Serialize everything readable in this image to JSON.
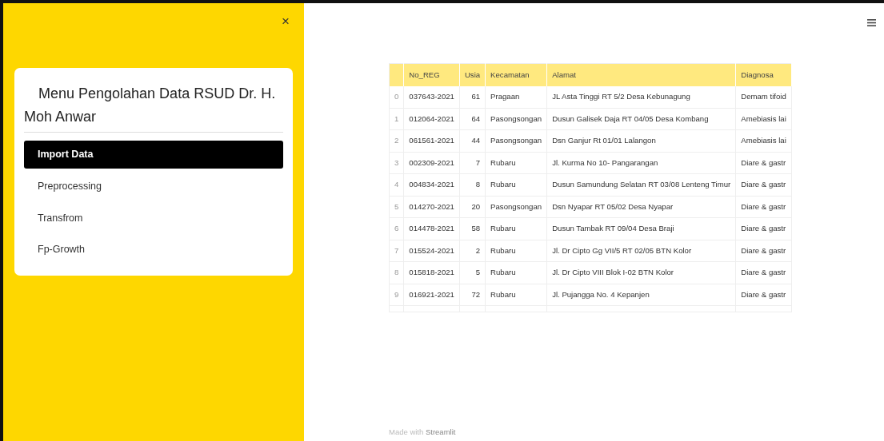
{
  "sidebar": {
    "close_label": "×",
    "menu_title": "Menu Pengolahan Data RSUD Dr. H. Moh Anwar",
    "items": [
      {
        "label": "Import Data",
        "selected": true
      },
      {
        "label": "Preprocessing",
        "selected": false
      },
      {
        "label": "Transfrom",
        "selected": false
      },
      {
        "label": "Fp-Growth",
        "selected": false
      }
    ]
  },
  "table": {
    "columns": [
      "",
      "No_REG",
      "Usia",
      "Kecamatan",
      "Alamat",
      "Diagnosa"
    ],
    "rows": [
      [
        "0",
        "037643-2021",
        "61",
        "Pragaan",
        "JL Asta Tinggi RT 5/2 Desa Kebunagung",
        "Demam tifoid"
      ],
      [
        "1",
        "012064-2021",
        "64",
        "Pasongsongan",
        "Dusun Galisek Daja RT 04/05 Desa Kombang",
        "Amebiasis lai"
      ],
      [
        "2",
        "061561-2021",
        "44",
        "Pasongsongan",
        "Dsn Ganjur Rt 01/01 Lalangon",
        "Amebiasis lai"
      ],
      [
        "3",
        "002309-2021",
        "7",
        "Rubaru",
        "Jl. Kurma No 10- Pangarangan",
        "Diare & gastr"
      ],
      [
        "4",
        "004834-2021",
        "8",
        "Rubaru",
        "Dusun Samundung Selatan RT 03/08 Lenteng Timur",
        "Diare & gastr"
      ],
      [
        "5",
        "014270-2021",
        "20",
        "Pasongsongan",
        "Dsn Nyapar RT 05/02 Desa Nyapar",
        "Diare & gastr"
      ],
      [
        "6",
        "014478-2021",
        "58",
        "Rubaru",
        "Dusun Tambak RT 09/04 Desa Braji",
        "Diare & gastr"
      ],
      [
        "7",
        "015524-2021",
        "2",
        "Rubaru",
        "Jl. Dr Cipto Gg VII/5 RT 02/05 BTN Kolor",
        "Diare & gastr"
      ],
      [
        "8",
        "015818-2021",
        "5",
        "Rubaru",
        "Jl. Dr Cipto VIII Blok I-02 BTN Kolor",
        "Diare & gastr"
      ],
      [
        "9",
        "016921-2021",
        "72",
        "Rubaru",
        "Jl. Pujangga No. 4 Kepanjen",
        "Diare & gastr"
      ]
    ]
  },
  "footer": {
    "prefix": "Made with",
    "brand": "Streamlit"
  }
}
